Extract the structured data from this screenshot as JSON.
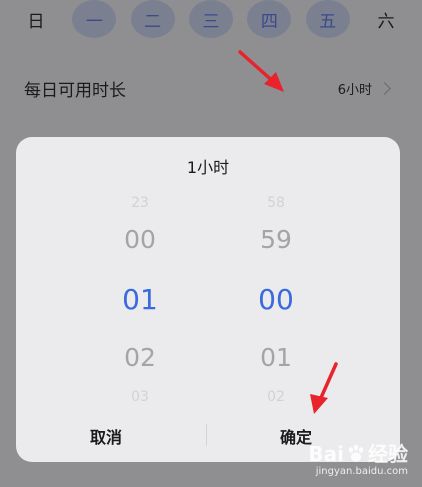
{
  "weekdays": [
    {
      "label": "日",
      "selected": false
    },
    {
      "label": "一",
      "selected": true
    },
    {
      "label": "二",
      "selected": true
    },
    {
      "label": "三",
      "selected": true
    },
    {
      "label": "四",
      "selected": true
    },
    {
      "label": "五",
      "selected": true
    },
    {
      "label": "六",
      "selected": false
    }
  ],
  "usage": {
    "label": "每日可用时长",
    "value": "6小时"
  },
  "dialog": {
    "title": "1小时",
    "hours": {
      "far_above": "23",
      "above": "00",
      "selected": "01",
      "below": "02",
      "far_below": "03"
    },
    "minutes": {
      "far_above": "58",
      "above": "59",
      "selected": "00",
      "below": "01",
      "far_below": "02"
    },
    "cancel_label": "取消",
    "confirm_label": "确定"
  },
  "watermark": {
    "brand": "Bai",
    "brand_suffix": "经验",
    "url": "jingyan.baidu.com"
  },
  "colors": {
    "overlay_bg": "#8f8f92",
    "dialog_bg": "#ebebed",
    "accent": "#3a6ae0",
    "annotation": "#e8232b"
  },
  "icons": [
    "chevron-right-icon",
    "red-arrow-icon",
    "baidu-paw-icon"
  ]
}
